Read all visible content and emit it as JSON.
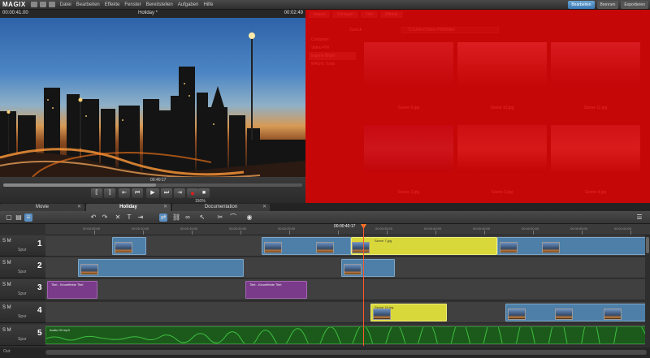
{
  "app": {
    "logo": "MAGIX",
    "menu": [
      "Datei",
      "Bearbeiten",
      "Effekte",
      "Fenster",
      "Bereitstellen",
      "Aufgaben",
      "Hilfe"
    ],
    "right_buttons": [
      "Bearbeiten",
      "Brennen",
      "Exportieren"
    ]
  },
  "preview": {
    "timecode_left": "00:00:41.00",
    "title": "Holiday *",
    "timecode_right": "00:02:49",
    "mini_time": "00:40:17",
    "zoom": "150%"
  },
  "media_pool": {
    "tabs": [
      "Import",
      "Vorlagen",
      "Titel",
      "Effekte"
    ],
    "path_label": "Zurück",
    "path": "C:\\Users\\Video-PM\\Bilder",
    "sidebar": [
      "Computer",
      "Video-PM",
      "Eigene Bilder",
      "MAGIX Tools"
    ],
    "thumbnails": [
      {
        "label": "Szene 9.jpg"
      },
      {
        "label": "Szene 10.jpg"
      },
      {
        "label": "Szene 11.jpg"
      },
      {
        "label": "Szene 2.jpg"
      },
      {
        "label": "Szene 3.jpg"
      },
      {
        "label": "Szene 4.jpg"
      }
    ]
  },
  "timeline": {
    "tabs": [
      "Movie",
      "Holiday",
      "Documentation"
    ],
    "ruler_time": "00:00:40:17",
    "tick_labels": [
      "00:00:05:00",
      "00:00:10:00",
      "00:00:15:00",
      "00:00:20:00",
      "00:00:25:00",
      "00:00:30:00",
      "00:00:35:00",
      "00:00:40:00",
      "00:00:45:00",
      "00:00:50:00",
      "00:00:55:00",
      "00:01:00:00"
    ],
    "track_label": "Spur",
    "track_sm": "S M",
    "tracks": [
      {
        "num": "1"
      },
      {
        "num": "2"
      },
      {
        "num": "3"
      },
      {
        "num": "4"
      },
      {
        "num": "5"
      }
    ],
    "clips": {
      "yellow1": "Szene 7.jpg",
      "yellow2": "Szene 10.jpg",
      "purple1": "Titel - Kinoeffekte Titel",
      "purple2": "Titel - Kinoeffekte Titel",
      "audio": "Audio 00 mp3"
    },
    "status": "Out:"
  },
  "colors": {
    "accent": "#5b8fc2",
    "record": "#e21b1b",
    "overlay": "#e90000",
    "playhead": "#ff5a2a"
  }
}
